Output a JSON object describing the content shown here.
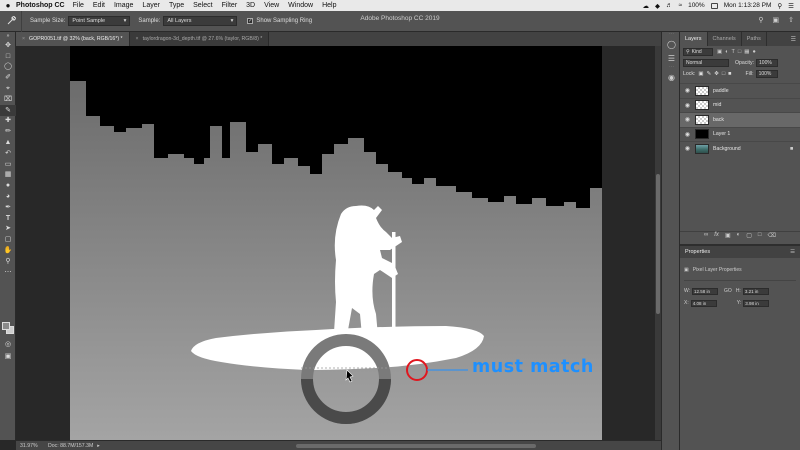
{
  "menubar": {
    "apple": "",
    "app_name": "Photoshop CC",
    "items": [
      "File",
      "Edit",
      "Image",
      "Layer",
      "Type",
      "Select",
      "Filter",
      "3D",
      "View",
      "Window",
      "Help"
    ],
    "battery": "100%",
    "clock": "Mon 1:13:28 PM"
  },
  "options_bar": {
    "window_title": "Adobe Photoshop CC 2019",
    "sample_size_label": "Sample Size:",
    "sample_size_value": "Point Sample",
    "sample_label": "Sample:",
    "sample_value": "All Layers",
    "show_ring_label": "Show Sampling Ring",
    "show_ring_checked": true
  },
  "tabs": [
    {
      "title": "GOPR0051.tif @ 32% (back, RGB/16*) *",
      "active": true
    },
    {
      "title": "taylordragon-3d_depth.tif @ 27.6% (taylor, RGB/8) *",
      "active": false
    }
  ],
  "annotation": {
    "text": "must match",
    "color": "#1e90ff",
    "circle_color": "#e0161e"
  },
  "status_bar": {
    "zoom": "31.97%",
    "doc": "Doc: 88.7M/157.3M"
  },
  "layers_panel": {
    "tabs": [
      "Layers",
      "Channels",
      "Paths"
    ],
    "kind_label": "Kind",
    "blend_mode": "Normal",
    "opacity_label": "Opacity:",
    "opacity_value": "100%",
    "lock_label": "Lock:",
    "fill_label": "Fill:",
    "fill_value": "100%",
    "layers": [
      {
        "name": "paddle",
        "thumb": "checker",
        "visible": true,
        "selected": false,
        "locked": false
      },
      {
        "name": "mid",
        "thumb": "checker",
        "visible": true,
        "selected": false,
        "locked": false
      },
      {
        "name": "back",
        "thumb": "checker",
        "visible": true,
        "selected": true,
        "locked": false
      },
      {
        "name": "Layer 1",
        "thumb": "black",
        "visible": true,
        "selected": false,
        "locked": false
      },
      {
        "name": "Background",
        "thumb": "photo",
        "visible": true,
        "selected": false,
        "locked": true
      }
    ]
  },
  "properties_panel": {
    "title": "Properties",
    "subtitle": "Pixel Layer Properties",
    "w_label": "W:",
    "w_value": "12.58 in",
    "go_label": "GO",
    "h_label": "H:",
    "h_value": "3.21 in",
    "x_label": "X:",
    "x_value": "4.08 in",
    "y_label": "Y:",
    "y_value": "3.98 in"
  }
}
